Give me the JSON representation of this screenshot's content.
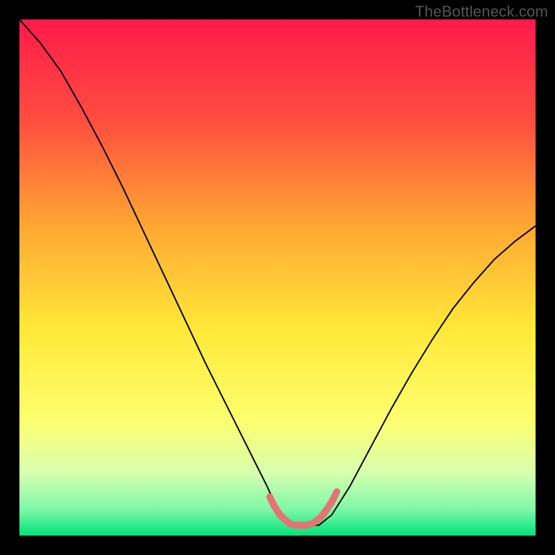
{
  "watermark": "TheBottleneck.com",
  "chart_data": {
    "type": "line",
    "title": "",
    "xlabel": "",
    "ylabel": "",
    "xlim": [
      0,
      1
    ],
    "ylim": [
      0,
      1
    ],
    "background_gradient": {
      "stops": [
        {
          "offset": 0.0,
          "color": "#ff1a4b"
        },
        {
          "offset": 0.2,
          "color": "#ff4f3f"
        },
        {
          "offset": 0.4,
          "color": "#ffa733"
        },
        {
          "offset": 0.6,
          "color": "#ffe838"
        },
        {
          "offset": 0.78,
          "color": "#fcff70"
        },
        {
          "offset": 0.88,
          "color": "#d6ffb0"
        },
        {
          "offset": 0.95,
          "color": "#7cf7a7"
        },
        {
          "offset": 1.0,
          "color": "#00e37a"
        }
      ]
    },
    "series": [
      {
        "name": "bottleneck-curve",
        "color": "#000000",
        "width": 2,
        "x": [
          0.0,
          0.04,
          0.08,
          0.12,
          0.16,
          0.2,
          0.24,
          0.28,
          0.32,
          0.36,
          0.4,
          0.44,
          0.48,
          0.505,
          0.53,
          0.555,
          0.58,
          0.605,
          0.64,
          0.68,
          0.72,
          0.76,
          0.8,
          0.84,
          0.88,
          0.92,
          0.96,
          1.0
        ],
        "y": [
          1.0,
          0.955,
          0.9,
          0.83,
          0.755,
          0.675,
          0.59,
          0.505,
          0.42,
          0.335,
          0.255,
          0.175,
          0.095,
          0.04,
          0.02,
          0.02,
          0.02,
          0.04,
          0.095,
          0.17,
          0.245,
          0.315,
          0.38,
          0.44,
          0.49,
          0.535,
          0.57,
          0.6
        ]
      },
      {
        "name": "valley-highlight",
        "color": "#e57373",
        "width": 10,
        "x": [
          0.485,
          0.495,
          0.505,
          0.515,
          0.525,
          0.535,
          0.545,
          0.555,
          0.565,
          0.575,
          0.585,
          0.595,
          0.605,
          0.615
        ],
        "y": [
          0.075,
          0.055,
          0.04,
          0.03,
          0.022,
          0.02,
          0.02,
          0.02,
          0.022,
          0.028,
          0.037,
          0.05,
          0.065,
          0.085
        ]
      }
    ]
  }
}
